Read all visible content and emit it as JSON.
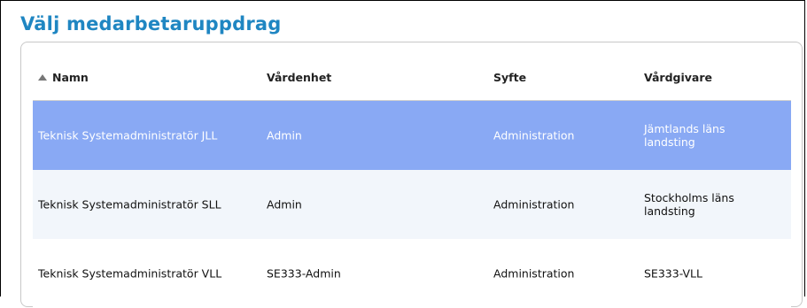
{
  "dialog": {
    "title": "Välj medarbetaruppdrag"
  },
  "table": {
    "columns": [
      {
        "label": "Namn",
        "sorted": "ascending"
      },
      {
        "label": "Vårdenhet"
      },
      {
        "label": "Syfte"
      },
      {
        "label": "Vårdgivare"
      }
    ],
    "rows": [
      {
        "namn": "Teknisk Systemadministratör JLL",
        "vardenhet": "Admin",
        "syfte": "Administration",
        "vardgivare": "Jämtlands läns landsting",
        "selected": true
      },
      {
        "namn": "Teknisk Systemadministratör SLL",
        "vardenhet": "Admin",
        "syfte": "Administration",
        "vardgivare": "Stockholms läns landsting",
        "selected": false
      },
      {
        "namn": "Teknisk Systemadministratör VLL",
        "vardenhet": "SE333-Admin",
        "syfte": "Administration",
        "vardgivare": "SE333-VLL",
        "selected": false
      }
    ]
  },
  "colors": {
    "title": "#1f86c2",
    "selected_row": "#89a9f4",
    "alt_row": "#f2f6fb"
  },
  "icons": {
    "sort": "sort-ascending-icon"
  }
}
